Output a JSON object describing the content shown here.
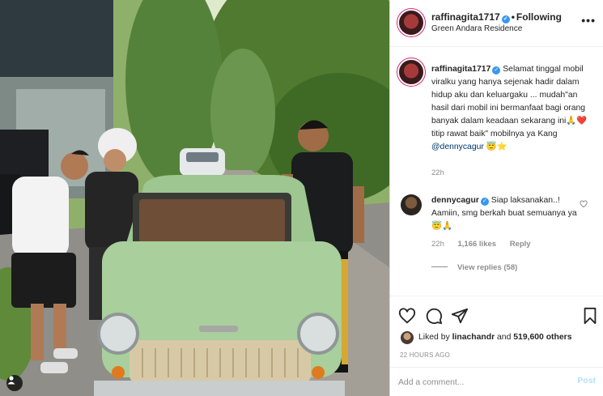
{
  "post": {
    "username": "raffinagita1717",
    "follow_status": "Following",
    "location": "Green Andara Residence",
    "caption": {
      "username": "raffinagita1717",
      "text_before_mention": "Selamat tinggal mobil viralku yang hanya sejenak hadir dalam hidup aku dan keluargaku ... mudah\"an hasil dari mobil ini bermanfaat bagi orang banyak dalam keadaan sekarang ini🙏❤️ titip rawat baik\" mobilnya ya Kang",
      "mention": "@dennycagur",
      "emoji_after": "😇⭐",
      "time": "22h"
    },
    "reply": {
      "username": "dennycagur",
      "text": "Siap laksanakan..! Aamiin, smg berkah buat semuanya ya 😇🙏",
      "time": "22h",
      "likes": "1,166 likes",
      "reply_label": "Reply",
      "view_replies": "View replies (58)"
    },
    "likes": {
      "prefix": "Liked by",
      "user": "linachandr",
      "connector": "and",
      "count": "519,600 others"
    },
    "timestamp": "22 HOURS AGO",
    "comment_placeholder": "Add a comment...",
    "post_label": "Post"
  },
  "icons": {
    "more": "more-options-icon",
    "like": "heart-icon",
    "comment": "comment-icon",
    "share": "share-icon",
    "save": "bookmark-icon",
    "tagged": "user-tag-icon"
  },
  "colors": {
    "verified": "#3897f0",
    "link": "#00376b",
    "secondary_text": "#8e8e8e",
    "post_disabled": "#b2dffc",
    "car_body": "#a8cf9c"
  }
}
